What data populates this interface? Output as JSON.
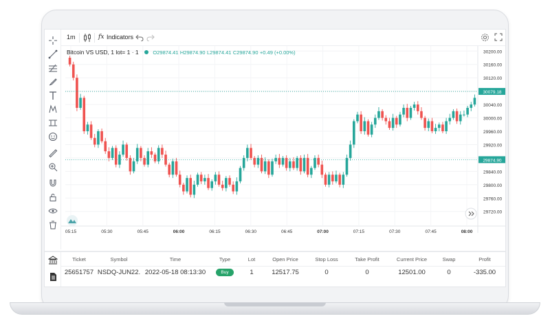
{
  "toolbar": {
    "interval": "1m",
    "indicators_label": "Indicators",
    "fx_symbol": "fx"
  },
  "legend": {
    "symbol_text": "Bitcoin VS USD, 1 lot= 1 · 1",
    "open": "O29874.41",
    "high": "H29874.90",
    "low": "L29874.41",
    "close": "C29874.90",
    "change": "+0.49 (+0.00%)"
  },
  "icons": {
    "toolbar": [
      "candles-icon",
      "fx-icon",
      "undo-icon",
      "redo-icon",
      "settings-icon",
      "fullscreen-icon"
    ],
    "tools": [
      "crosshair-icon",
      "trendline-icon",
      "fib-icon",
      "brush-icon",
      "text-icon",
      "pattern-icon",
      "measure-icon",
      "emoji-icon",
      "ruler-icon",
      "zoom-icon",
      "magnet-icon",
      "lock-icon",
      "eye-icon",
      "trash-icon"
    ]
  },
  "colors": {
    "up": "#26a69a",
    "down": "#ef5350",
    "buy_badge": "#27a36a",
    "negative_profit": "#e25a5a",
    "price_tag": "#26a69a"
  },
  "chart_data": {
    "type": "candlestick",
    "x_ticks": [
      "05:15",
      "05:30",
      "05:45",
      "06:00",
      "06:15",
      "06:30",
      "06:45",
      "07:00",
      "07:15",
      "07:30",
      "07:45",
      "08:00"
    ],
    "bold_ticks": [
      "06:00",
      "07:00",
      "08:00"
    ],
    "y_ticks": [
      "30200.00",
      "30160.00",
      "30120.00",
      "30080.00",
      "30040.00",
      "30000.00",
      "29960.00",
      "29920.00",
      "29880.00",
      "29840.00",
      "29800.00",
      "29760.00",
      "29720.00"
    ],
    "ylim": [
      29705,
      30215
    ],
    "price_tags": [
      {
        "label": "30079.18",
        "value": 30079.18
      },
      {
        "label": "29874.90",
        "value": 29874.9
      }
    ],
    "series": [
      {
        "values": [
          30160,
          30120,
          30030,
          30060,
          29960,
          29980,
          29940,
          29920,
          29960,
          29930,
          29900,
          29880,
          29910,
          29860,
          29890,
          29920,
          29880,
          29840,
          29870,
          29910,
          29880,
          29860,
          29900,
          29890,
          29870,
          29910,
          29890,
          29860,
          29830,
          29870,
          29830,
          29800,
          29780,
          29820,
          29770,
          29800,
          29830,
          29810,
          29820,
          29790,
          29810,
          29830,
          29800,
          29790,
          29820,
          29800,
          29780,
          29810,
          29850,
          29880,
          29910,
          29880,
          29860,
          29880,
          29840,
          29870,
          29830,
          29870,
          29880,
          29860,
          29880,
          29850,
          29870,
          29850,
          29880,
          29840,
          29880,
          29830,
          29850,
          29880,
          29860,
          29830,
          29800,
          29830,
          29810,
          29830,
          29800,
          29830,
          29880,
          29920,
          29990,
          30010,
          29960,
          29990,
          29950,
          29980,
          30000,
          30020,
          30000,
          29990,
          29970,
          30000,
          29980,
          30010,
          30030,
          30000,
          30030,
          30040,
          30020,
          30000,
          29970,
          29990,
          29960,
          29970,
          29980,
          29960,
          29990,
          30000,
          30020,
          29990,
          30010,
          30010,
          30030,
          30040,
          30060
        ]
      }
    ]
  },
  "positions": {
    "columns": [
      "Ticket",
      "Symbol",
      "Time",
      "Type",
      "Lot",
      "Open Price",
      "Stop Loss",
      "Take Profit",
      "Current Price",
      "Swap",
      "Profit"
    ],
    "row": {
      "ticket": "25651757",
      "symbol": "NSDQ-JUN22.",
      "time": "2022-05-18 08:13:30",
      "type": "Buy",
      "lot": "1",
      "open_price": "12517.75",
      "stop_loss": "0",
      "take_profit": "0",
      "current_price": "12501.00",
      "swap": "0",
      "profit": "-335.00"
    }
  }
}
